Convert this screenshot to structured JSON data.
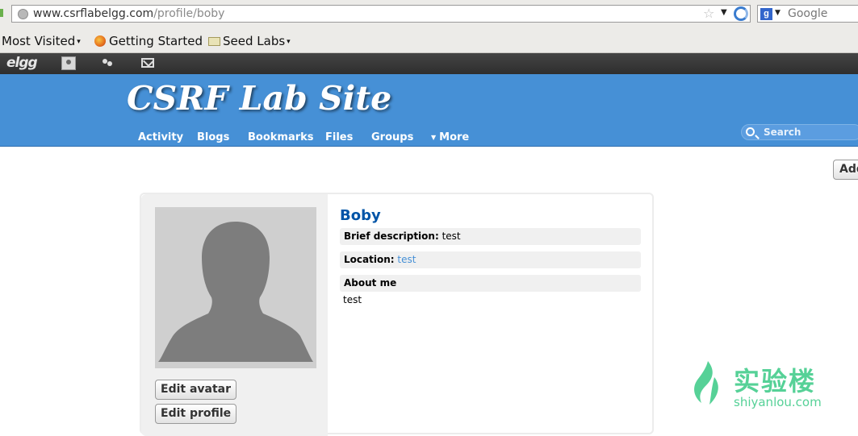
{
  "browser": {
    "url_host": "www.csrflabelgg.com",
    "url_path": "/profile/boby",
    "search_engine_icon": "g",
    "search_placeholder": "Google"
  },
  "bookmarks": {
    "items": [
      {
        "label": "Most Visited",
        "caret": "▾"
      },
      {
        "label": "Getting Started"
      },
      {
        "label": "Seed Labs",
        "caret": "▾"
      }
    ]
  },
  "topbar": {
    "logo": "elgg"
  },
  "site": {
    "title": "CSRF Lab Site",
    "nav": [
      "Activity",
      "Blogs",
      "Bookmarks",
      "Files",
      "Groups",
      "More"
    ],
    "more_caret": "▼",
    "search_placeholder": "Search",
    "add_button": "Add"
  },
  "profile": {
    "name": "Boby",
    "brief_description_label": "Brief description:",
    "brief_description": "test",
    "location_label": "Location:",
    "location": "test",
    "about_label": "About me",
    "about": "test",
    "edit_avatar": "Edit avatar",
    "edit_profile": "Edit profile"
  },
  "watermark": {
    "cn": "实验楼",
    "en": "shiyanlou.com"
  },
  "colors": {
    "header_blue": "#4690d6",
    "name_blue": "#0054a7",
    "watermark_green": "#56d197"
  }
}
